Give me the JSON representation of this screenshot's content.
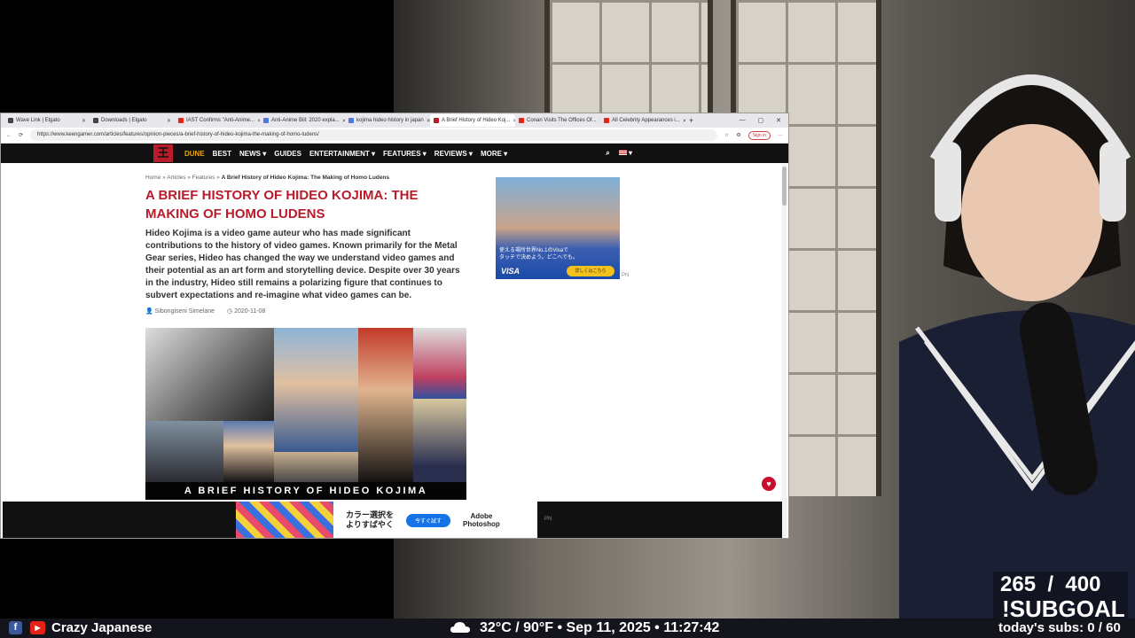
{
  "browser": {
    "tabs": [
      {
        "label": "Wave Link | Elgato",
        "fav": "#444"
      },
      {
        "label": "Downloads | Elgato",
        "fav": "#444"
      },
      {
        "label": "IAST Confirms \"Anti-Anime...",
        "fav": "#e62117"
      },
      {
        "label": "Anti-Anime Bill: 2020 expla...",
        "fav": "#4a7bd8"
      },
      {
        "label": "kojima hideo history in japan",
        "fav": "#4a7bd8"
      },
      {
        "label": "A Brief History of Hideo Koj...",
        "fav": "#b81c2b"
      },
      {
        "label": "Conan Visits The Offices Of...",
        "fav": "#e62117"
      },
      {
        "label": "All Celebrity Appearances i...",
        "fav": "#e62117"
      }
    ],
    "url": "https://www.keengamer.com/articles/features/opinion-pieces/a-brief-history-of-hideo-kojima-the-making-of-homo-ludens/",
    "signin": "Sign in"
  },
  "site": {
    "logo": "王",
    "nav": [
      "DUNE",
      "BEST",
      "NEWS ▾",
      "GUIDES",
      "ENTERTAINMENT ▾",
      "FEATURES ▾",
      "REVIEWS ▾",
      "MORE ▾"
    ],
    "flag": "▾"
  },
  "article": {
    "breadcrumb_prefix": "Home » Articles » Features » ",
    "breadcrumb_current": "A Brief History of Hideo Kojima: The Making of Homo Ludens",
    "title": "A Brief History of Hideo Kojima: The Making of Homo Ludens",
    "intro": "Hideo Kojima is a video game auteur who has made significant contributions to the history of video games. Known primarily for the Metal Gear series, Hideo has changed the way we understand video games and their potential as an art form and storytelling device. Despite over 30 years in the industry, Hideo still remains a polarizing figure that continues to subvert expectations and re-imagine what video games can be.",
    "author": "Sibongiseni Simelane",
    "date": "2020-11-08",
    "hero_caption": "A BRIEF HISTORY OF HIDEO KOJIMA"
  },
  "ads": {
    "side_text": "使える場所世界No.1のVisaで\nタッチで決めよう。どこへでも。",
    "side_brand": "VISA",
    "side_cta": "詳しくはこちら",
    "pn": "PN",
    "bottom_text": "カラー選択を\nよりすばやく",
    "bottom_btn": "今すぐ試す",
    "bottom_brand": "Adobe\nPhotoshop"
  },
  "overlay": {
    "goal_count": "265  /  400",
    "goal_label": "!SUBGOAL",
    "stream_name": "Crazy Japanese",
    "weather": "32°C / 90°F • Sep 11, 2025 • 11:27:42",
    "today_subs": "today's subs: 0 / 60"
  }
}
